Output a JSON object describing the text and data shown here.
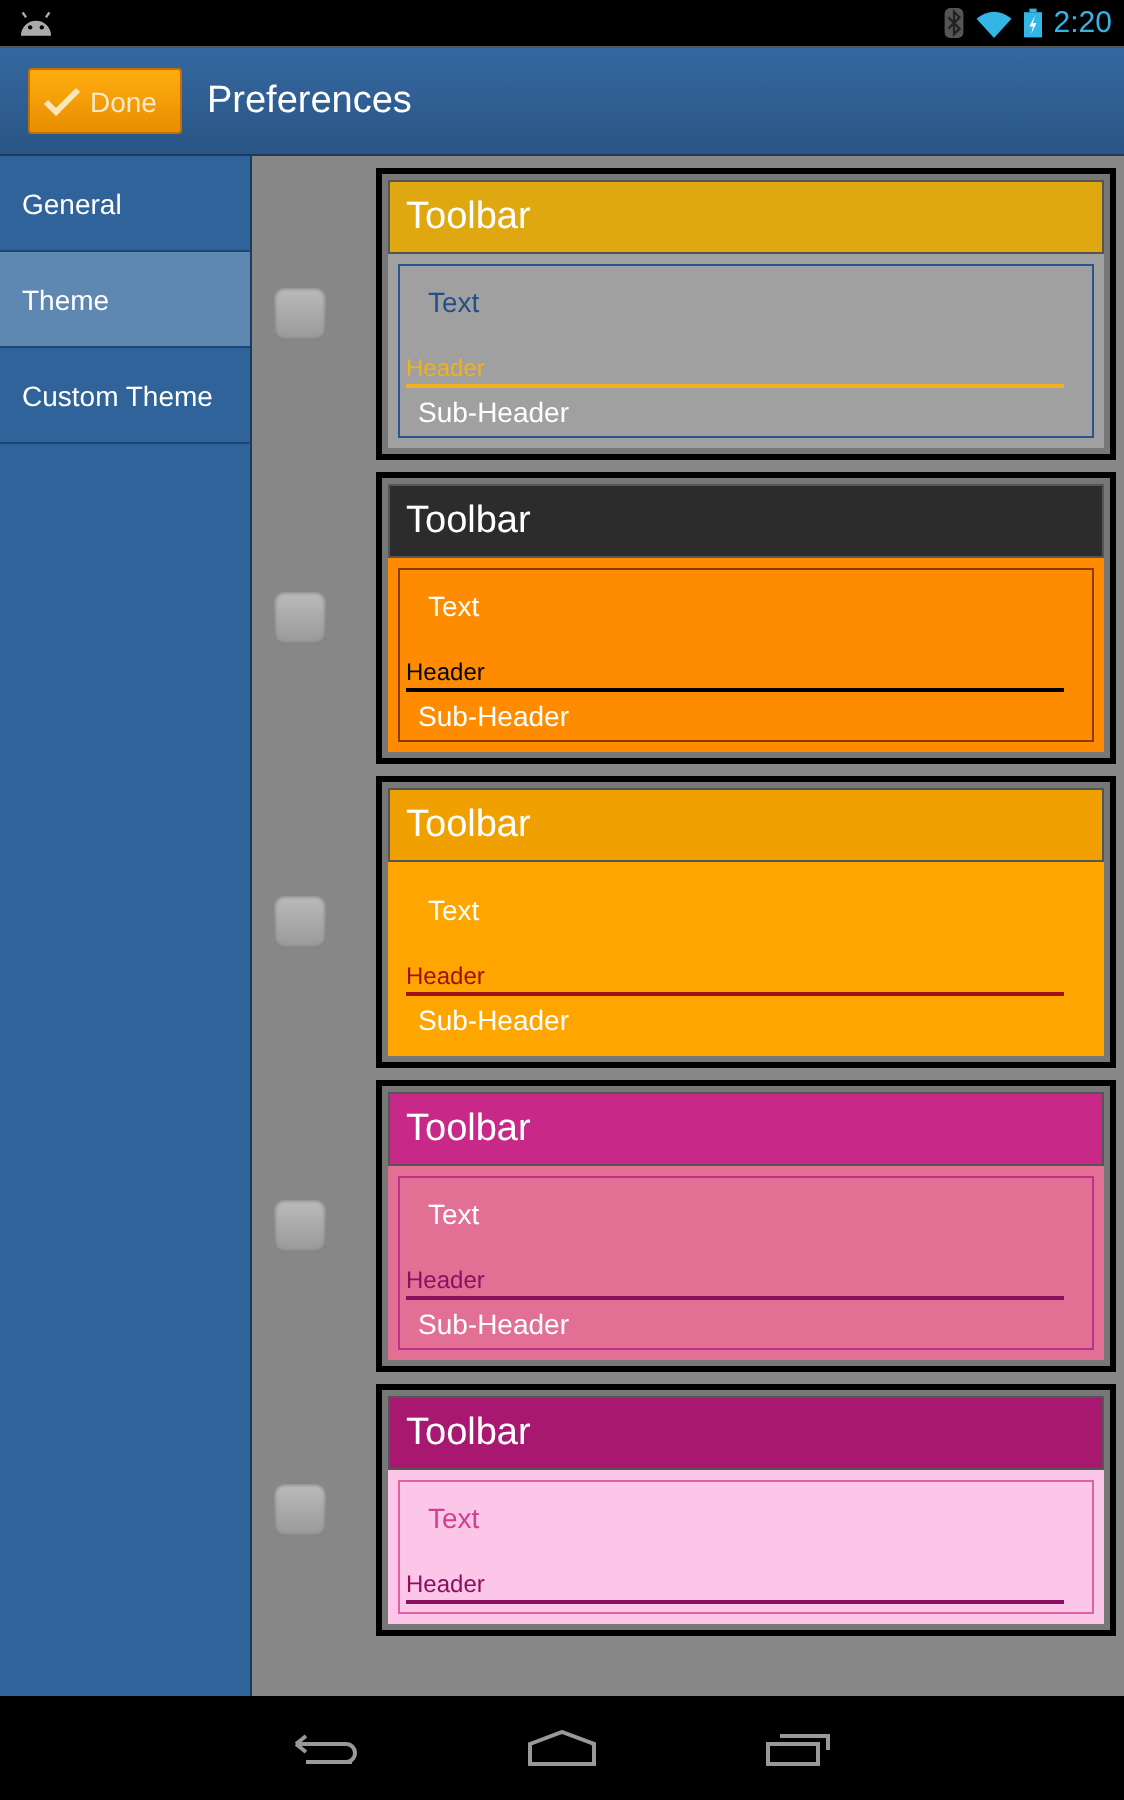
{
  "status_bar": {
    "time": "2:20"
  },
  "action_bar": {
    "done_label": "Done",
    "title": "Preferences"
  },
  "sidebar": {
    "items": [
      {
        "label": "General",
        "selected": false
      },
      {
        "label": "Theme",
        "selected": true
      },
      {
        "label": "Custom Theme",
        "selected": false
      }
    ]
  },
  "themes": [
    {
      "checked": false,
      "toolbar": {
        "label": "Toolbar",
        "color": "#e0a810"
      },
      "body": {
        "color": "#a0a0a0"
      },
      "frame": {
        "color": "#2a5590"
      },
      "text": {
        "label": "Text",
        "color": "#23508a"
      },
      "header": {
        "label": "Header",
        "color": "#f0b020"
      },
      "sub_header": {
        "label": "Sub-Header",
        "color": "#ffffff"
      }
    },
    {
      "checked": false,
      "toolbar": {
        "label": "Toolbar",
        "color": "#2c2c2c"
      },
      "body": {
        "color": "#ff8c00"
      },
      "frame": {
        "color": "#8a3c00"
      },
      "text": {
        "label": "Text",
        "color": "#ffffff"
      },
      "header": {
        "label": "Header",
        "color": "#000000"
      },
      "sub_header": {
        "label": "Sub-Header",
        "color": "#ffffff"
      }
    },
    {
      "checked": false,
      "toolbar": {
        "label": "Toolbar",
        "color": "#f0a000"
      },
      "body": {
        "color": "#ffa500"
      },
      "frame": {
        "color": "#ffa500"
      },
      "text": {
        "label": "Text",
        "color": "#ffffff"
      },
      "header": {
        "label": "Header",
        "color": "#a01010"
      },
      "sub_header": {
        "label": "Sub-Header",
        "color": "#ffffff"
      }
    },
    {
      "checked": false,
      "toolbar": {
        "label": "Toolbar",
        "color": "#c82888"
      },
      "body": {
        "color": "#e27095"
      },
      "frame": {
        "color": "#c0308a"
      },
      "text": {
        "label": "Text",
        "color": "#ffffff"
      },
      "header": {
        "label": "Header",
        "color": "#8a1060"
      },
      "sub_header": {
        "label": "Sub-Header",
        "color": "#ffffff"
      }
    },
    {
      "checked": false,
      "toolbar": {
        "label": "Toolbar",
        "color": "#a81870"
      },
      "body": {
        "color": "#fbc6e8"
      },
      "frame": {
        "color": "#e060a0"
      },
      "text": {
        "label": "Text",
        "color": "#d04090"
      },
      "header": {
        "label": "Header",
        "color": "#8a1060"
      }
    }
  ]
}
